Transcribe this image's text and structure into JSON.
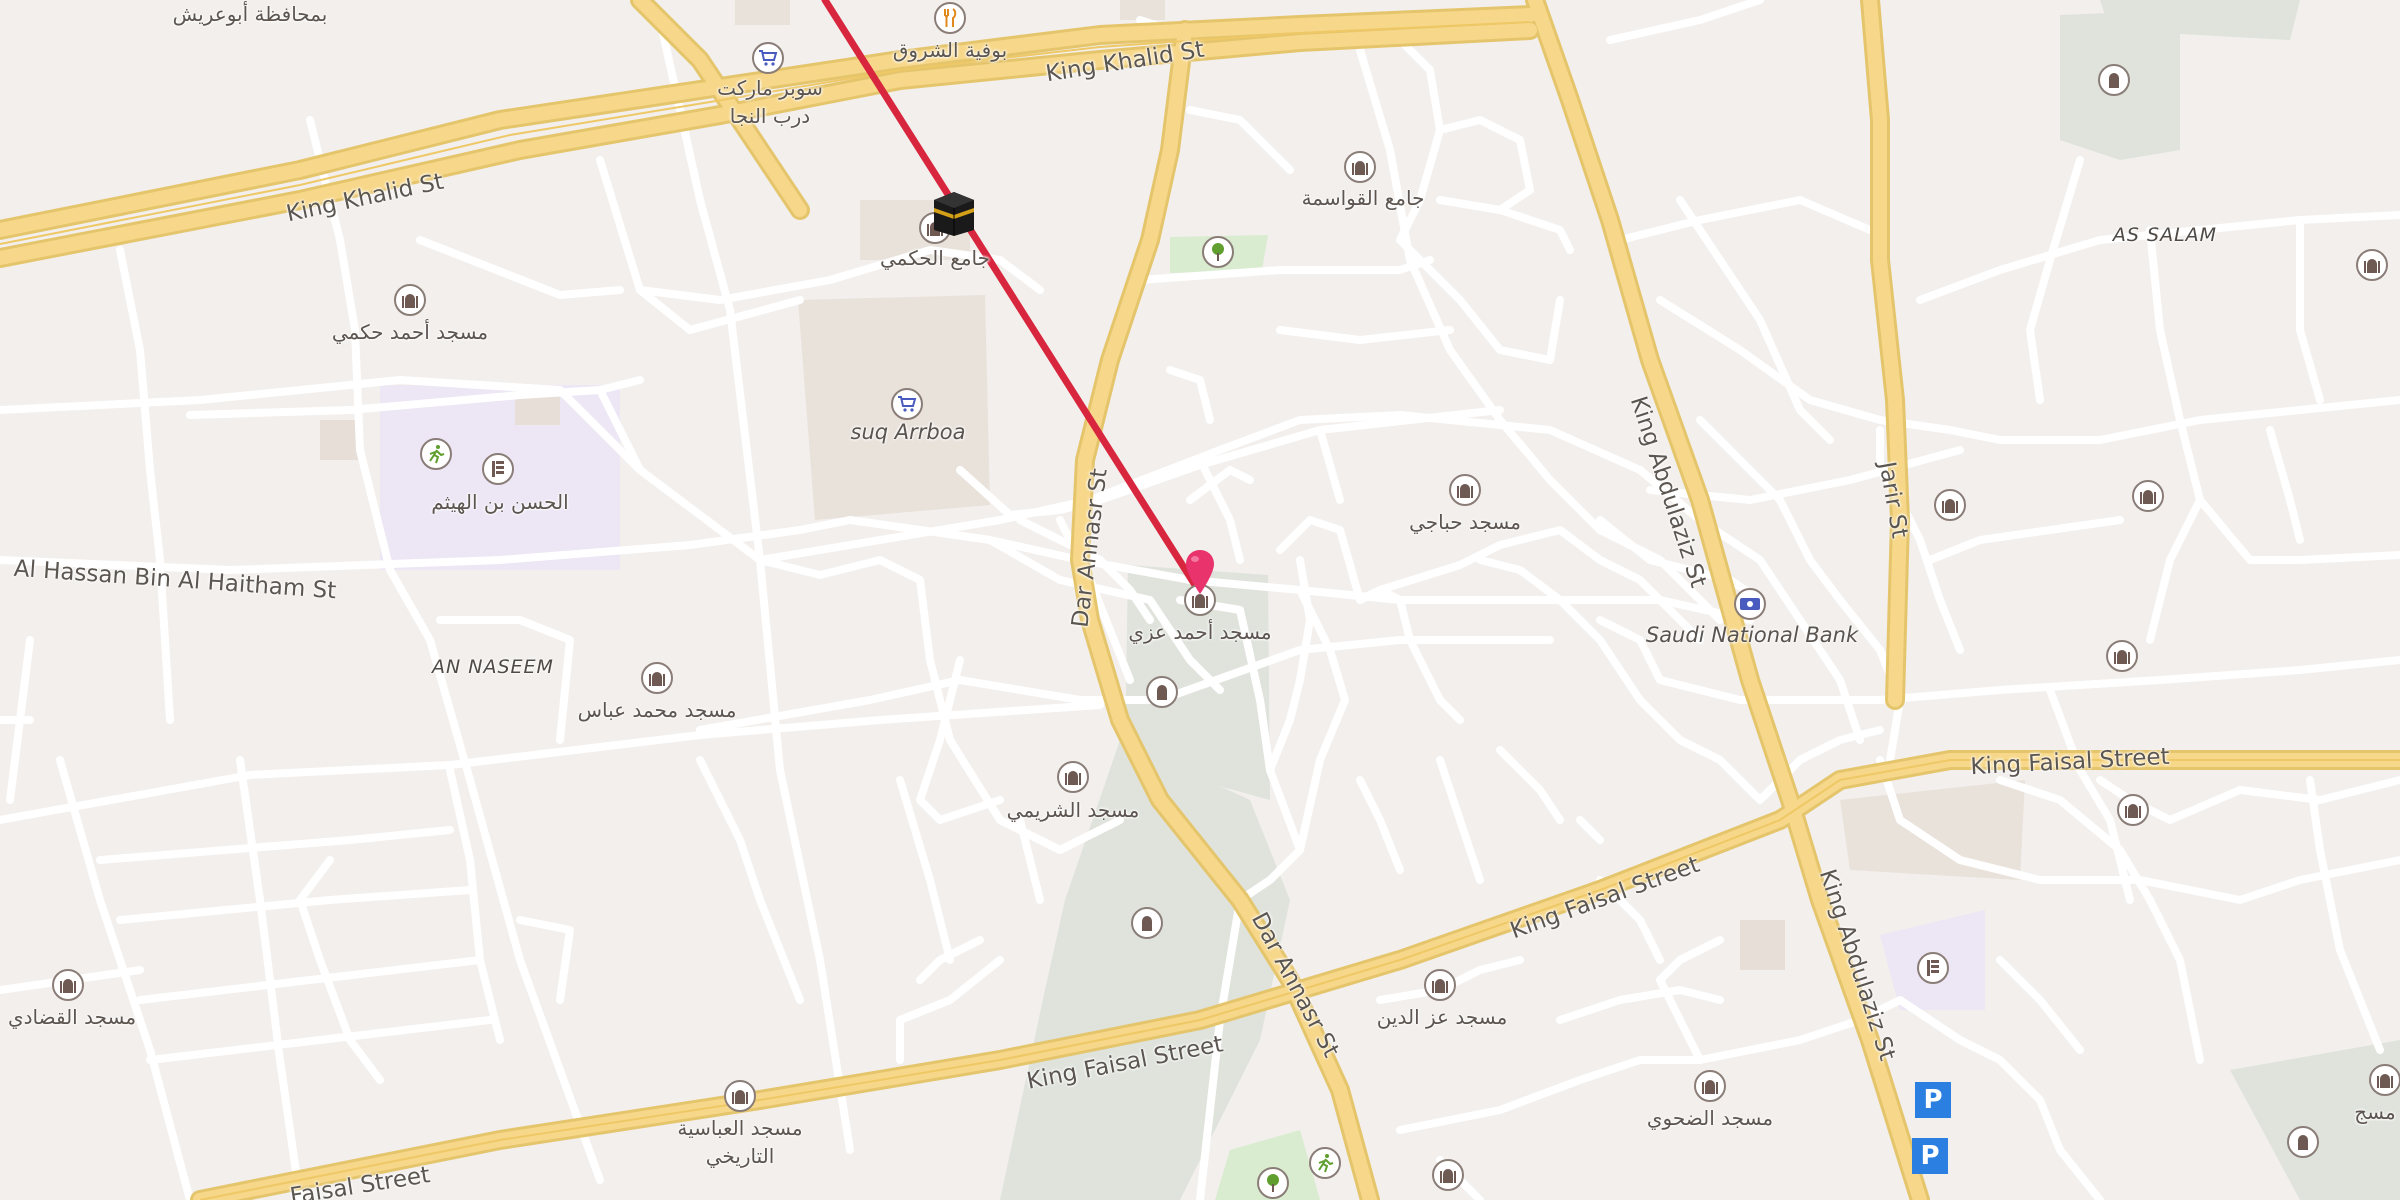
{
  "map": {
    "streets": {
      "king_khalid_1": "King Khalid St",
      "king_khalid_2": "King Khalid St",
      "al_hassan": "Al Hassan Bin Al Haitham St",
      "dar_annasr_1": "Dar Annasr St",
      "dar_annasr_2": "Dar Annasr St",
      "king_abdulaziz_1": "King Abdulaziz St",
      "king_abdulaziz_2": "King Abdulaziz St",
      "jarir": "Jarir St",
      "king_faisal_1": "King Faisal Street",
      "king_faisal_2": "King Faisal Street",
      "king_faisal_3": "King Faisal Street",
      "faisal_partial": "Faisal Street"
    },
    "districts": {
      "an_naseem": "AN NASEEM",
      "as_salam": "AS SALAM"
    },
    "places": {
      "abu_arish": "بمحافظة أبوعريش",
      "shurooq": "بوفية الشروق",
      "supermarket_1": "سوبر ماركت",
      "supermarket_2": "درب النجا",
      "jami_alhakmi": "جامع الحكمي",
      "jami_qawasima": "جامع القواسمة",
      "masjid_ahmed_hakmi": "مسجد أحمد حكمي",
      "suq_arrboa": "suq Arrboa",
      "alhasan_school": "الحسن بن الهيثم",
      "masjid_hajji": "مسجد حباجي",
      "masjid_ahmed_azi": "مسجد أحمد عزي",
      "saudi_bank": "Saudi National Bank",
      "masjid_mohammed_abbas": "مسجد محمد عباس",
      "masjid_shuraimi": "مسجد الشريمي",
      "masjid_qadi": "مسجد القضادي",
      "masjid_izz": "مسجد عز الدين",
      "masjid_abbasiya_1": "مسجد العباسية",
      "masjid_abbasiya_2": "التاريخي",
      "masjid_dahwi": "مسجد الضحوي",
      "masjid_right_edge": "مسج"
    },
    "colors": {
      "background": "#f2efec",
      "minor_road": "#ffffff",
      "major_road": "#f7d88a",
      "route_line": "#d7263d",
      "park": "#dfe3dc",
      "school": "#ece6f5",
      "pin": "#e8336d",
      "parking": "#2a7fe0"
    },
    "icons": [
      "mosque-icon",
      "cart-icon",
      "fork-knife-icon",
      "tree-icon",
      "runner-icon",
      "school-icon",
      "cemetery-icon",
      "bank-icon",
      "parking-icon",
      "kaaba-icon",
      "location-pin-icon"
    ],
    "parking_label": "P"
  }
}
